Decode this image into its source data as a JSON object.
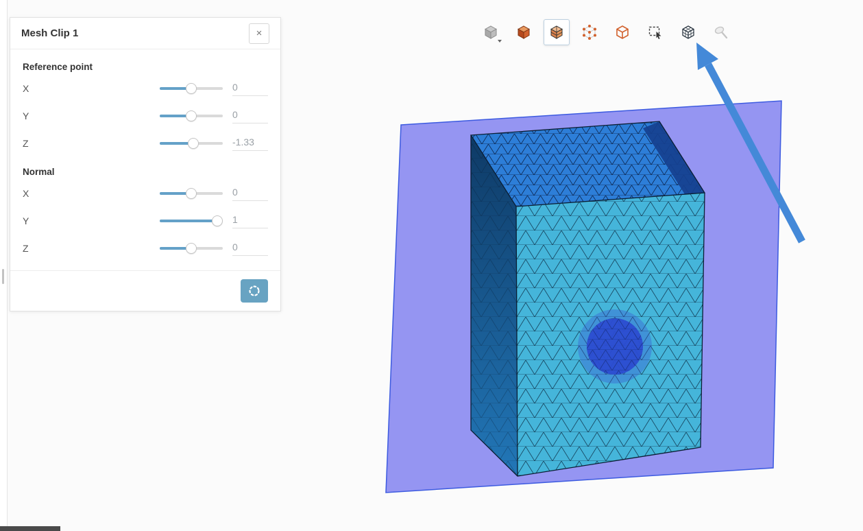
{
  "panel": {
    "title": "Mesh Clip 1",
    "close_icon": "×",
    "reference_point": {
      "label": "Reference point",
      "rows": [
        {
          "axis": "X",
          "value": "0",
          "percent": 50
        },
        {
          "axis": "Y",
          "value": "0",
          "percent": 50
        },
        {
          "axis": "Z",
          "value": "-1.33",
          "percent": 53
        }
      ]
    },
    "normal": {
      "label": "Normal",
      "rows": [
        {
          "axis": "X",
          "value": "0",
          "percent": 50
        },
        {
          "axis": "Y",
          "value": "1",
          "percent": 91
        },
        {
          "axis": "Z",
          "value": "0",
          "percent": 50
        }
      ]
    }
  },
  "toolbar": {
    "buttons": [
      {
        "name": "render-mode-solid",
        "state": "default"
      },
      {
        "name": "view-surfaces",
        "state": "default"
      },
      {
        "name": "view-surfaces-with-edges",
        "state": "selected"
      },
      {
        "name": "view-points",
        "state": "default"
      },
      {
        "name": "view-wireframe",
        "state": "default"
      },
      {
        "name": "box-select",
        "state": "default"
      },
      {
        "name": "mesh-clip",
        "state": "default"
      },
      {
        "name": "probe-point",
        "state": "disabled"
      }
    ]
  },
  "colors": {
    "slider_fill": "#64a1c8",
    "apply_button": "#68a3c2",
    "plane_fill": "#6e6eee",
    "plane_stroke": "#3c5ae0",
    "mesh_front": "#45b5da",
    "mesh_top": "#2d7ed8",
    "inner_wall": "#16408f",
    "sphere_halo": "rgba(58,90,210,0.38)",
    "sphere_core": "#2b4bd0",
    "arrow": "#4489d8"
  }
}
